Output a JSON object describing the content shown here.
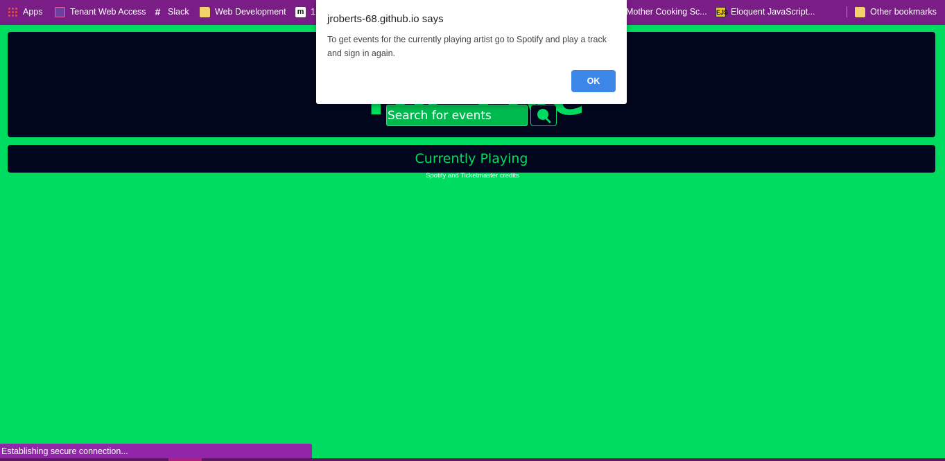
{
  "bookmarks": {
    "items": [
      {
        "label": "Apps",
        "icon": "apps-grid-icon"
      },
      {
        "label": "Tenant Web Access",
        "icon": "building-icon"
      },
      {
        "label": "Slack",
        "icon": "slack-icon"
      },
      {
        "label": "Web Development",
        "icon": "folder-icon"
      },
      {
        "label": "1",
        "icon": "medium-icon"
      },
      {
        "label": "Mother Cooking Sc...",
        "icon": "site-icon"
      },
      {
        "label": "Eloquent JavaScript...",
        "icon": "ejs-icon"
      },
      {
        "label": "Other bookmarks",
        "icon": "folder-icon"
      }
    ],
    "ejs_badge": "EJS",
    "medium_badge": "m"
  },
  "header": {
    "title": "The Live",
    "search_placeholder": "Search for events"
  },
  "playing": {
    "label": "Currently Playing",
    "credits": "Spotify and Ticketmaster credits"
  },
  "dialog": {
    "title": "jroberts-68.github.io says",
    "message": "To get events for the currently playing artist go to Spotify and play a track and sign in again.",
    "ok_label": "OK"
  },
  "status": {
    "text": "Establishing secure connection..."
  },
  "colors": {
    "page_bg": "#00dc5f",
    "panel_bg": "#03071e",
    "bookmarks_bg": "#7a1d86",
    "dialog_button": "#3b86e6"
  }
}
